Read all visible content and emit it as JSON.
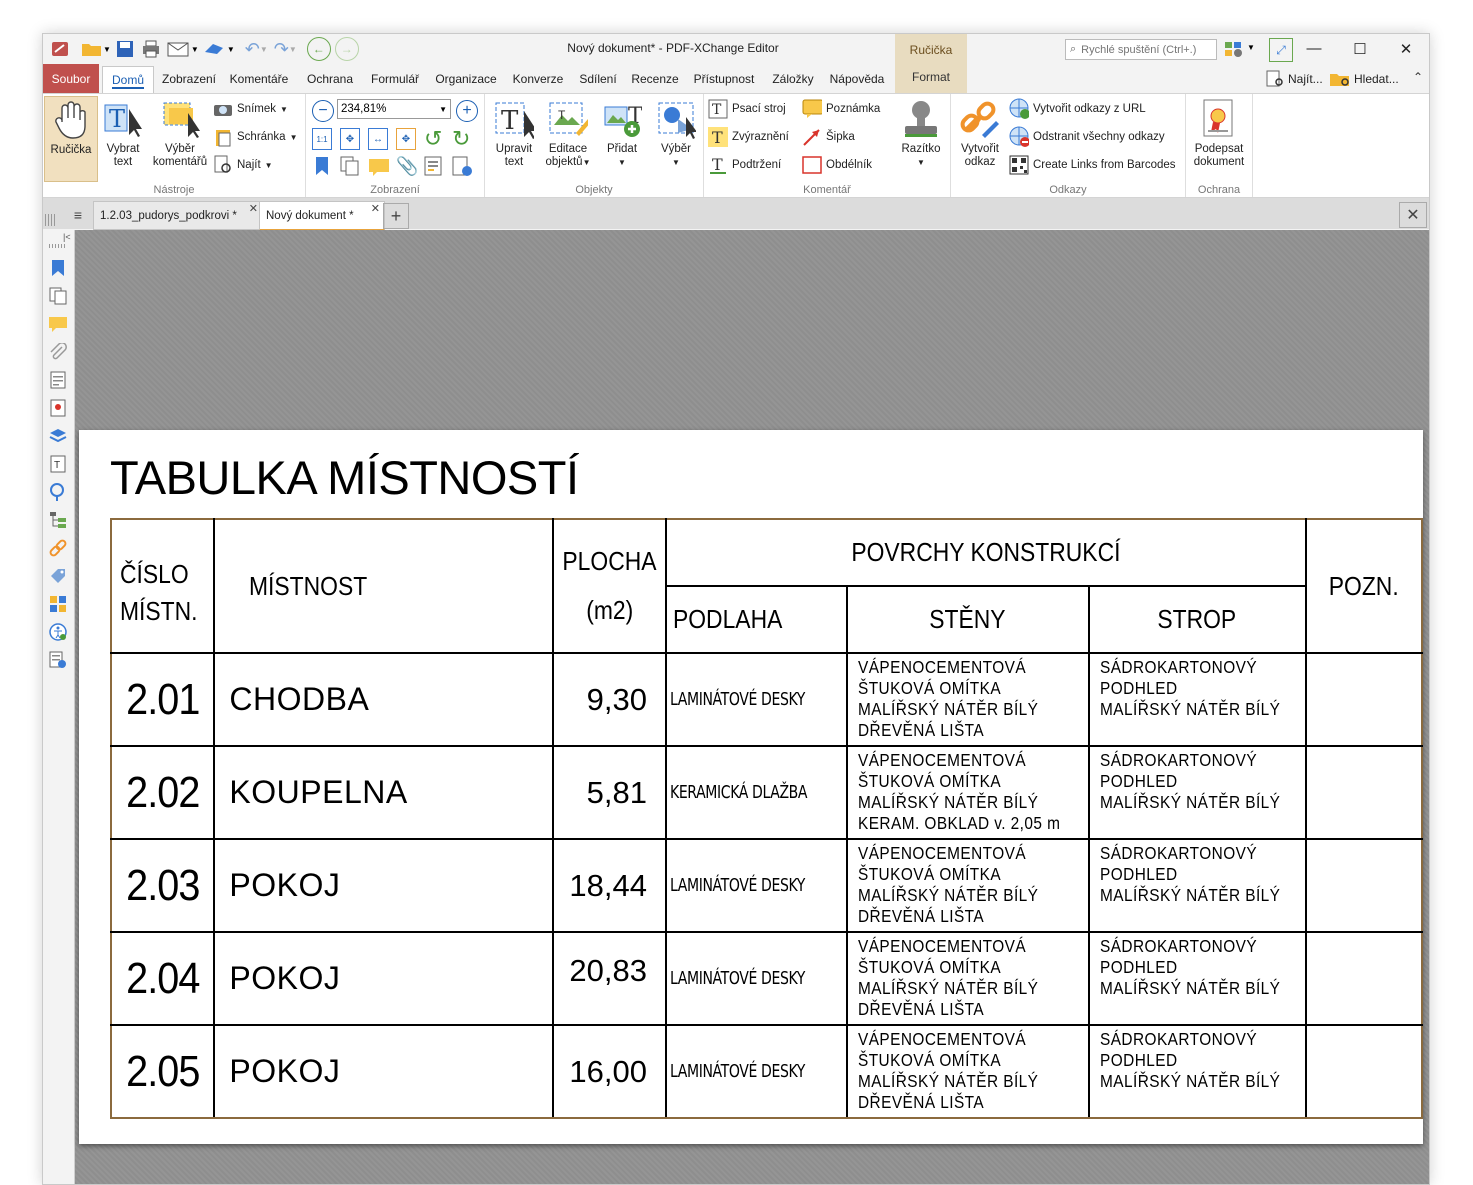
{
  "window": {
    "title": "Nový dokument* - PDF-XChange Editor",
    "context_group": "Ručička",
    "context_tab": "Format",
    "quick_launch_placeholder": "Rychlé spuštění (Ctrl+.)"
  },
  "menu": {
    "file": "Soubor",
    "tabs": [
      "Domů",
      "Zobrazení",
      "Komentáře",
      "Ochrana",
      "Formulář",
      "Organizace",
      "Konverze",
      "Sdílení",
      "Recenze",
      "Přístupnost",
      "Záložky",
      "Nápověda"
    ],
    "find_label": "Najít...",
    "search_label": "Hledat..."
  },
  "ribbon": {
    "tools": {
      "label": "Nástroje",
      "hand": "Ručička",
      "select_text": [
        "Vybrat",
        "text"
      ],
      "select_comments": [
        "Výběr",
        "komentářů"
      ],
      "snapshot": "Snímek",
      "clipboard": "Schránka",
      "find": "Najít"
    },
    "view": {
      "label": "Zobrazení",
      "zoom_value": "234,81%"
    },
    "objects": {
      "label": "Objekty",
      "edit_text": [
        "Upravit",
        "text"
      ],
      "edit_objects": [
        "Editace",
        "objektů"
      ],
      "add": "Přidat",
      "selection": "Výběr"
    },
    "comment": {
      "label": "Komentář",
      "typewriter": "Psací stroj",
      "highlight": "Zvýraznění",
      "underline": "Podtržení",
      "note": "Poznámka",
      "arrow": "Šipka",
      "rectangle": "Obdélník",
      "stamp": "Razítko"
    },
    "links": {
      "label": "Odkazy",
      "create_link": [
        "Vytvořit",
        "odkaz"
      ],
      "create_from_url": "Vytvořit odkazy z URL",
      "remove_all": "Odstranit všechny odkazy",
      "from_barcodes": "Create Links from Barcodes"
    },
    "protect": {
      "label": "Ochrana",
      "sign": [
        "Podepsat",
        "dokument"
      ]
    }
  },
  "doc_tabs": [
    "1.2.03_pudorys_podkrovi *",
    "Nový dokument *"
  ],
  "document": {
    "title": "TABULKA MÍSTNOSTÍ",
    "headers": {
      "number": [
        "ČÍSLO",
        "MÍSTN."
      ],
      "room": "MÍSTNOST",
      "area": [
        "PLOCHA",
        "(m2)"
      ],
      "surfaces": "POVRCHY KONSTRUKCÍ",
      "floor": "PODLAHA",
      "walls": "STĚNY",
      "ceiling": "STROP",
      "note": "POZN."
    },
    "rows": [
      {
        "number": "2.01",
        "room": "CHODBA",
        "area": "9,30",
        "floor": "LAMINÁTOVÉ DESKY",
        "walls": [
          "VÁPENOCEMENTOVÁ",
          "ŠTUKOVÁ OMÍTKA",
          "MALÍŘSKÝ NÁTĚR BÍLÝ",
          "DŘEVĚNÁ LIŠTA"
        ],
        "ceiling": [
          "SÁDROKARTONOVÝ",
          "PODHLED",
          "MALÍŘSKÝ NÁTĚR BÍLÝ"
        ]
      },
      {
        "number": "2.02",
        "room": "KOUPELNA",
        "area": "5,81",
        "floor": "KERAMICKÁ DLAŽBA",
        "walls": [
          "VÁPENOCEMENTOVÁ",
          "ŠTUKOVÁ OMÍTKA",
          "MALÍŘSKÝ NÁTĚR BÍLÝ",
          "KERAM. OBKLAD v. 2,05 m"
        ],
        "ceiling": [
          "SÁDROKARTONOVÝ",
          "PODHLED",
          "MALÍŘSKÝ NÁTĚR BÍLÝ"
        ]
      },
      {
        "number": "2.03",
        "room": "POKOJ",
        "area": "18,44",
        "floor": "LAMINÁTOVÉ DESKY",
        "walls": [
          "VÁPENOCEMENTOVÁ",
          "ŠTUKOVÁ OMÍTKA",
          "MALÍŘSKÝ NÁTĚR BÍLÝ",
          "DŘEVĚNÁ LIŠTA"
        ],
        "ceiling": [
          "SÁDROKARTONOVÝ",
          "PODHLED",
          "MALÍŘSKÝ NÁTĚR BÍLÝ"
        ]
      },
      {
        "number": "2.04",
        "room": "POKOJ",
        "area": "20,83",
        "floor": "LAMINÁTOVÉ DESKY",
        "walls": [
          "VÁPENOCEMENTOVÁ",
          "ŠTUKOVÁ OMÍTKA",
          "MALÍŘSKÝ NÁTĚR BÍLÝ",
          "DŘEVĚNÁ LIŠTA"
        ],
        "ceiling": [
          "SÁDROKARTONOVÝ",
          "PODHLED",
          "MALÍŘSKÝ NÁTĚR BÍLÝ"
        ]
      },
      {
        "number": "2.05",
        "room": "POKOJ",
        "area": "16,00",
        "floor": "LAMINÁTOVÉ DESKY",
        "walls": [
          "VÁPENOCEMENTOVÁ",
          "ŠTUKOVÁ OMÍTKA",
          "MALÍŘSKÝ NÁTĚR BÍLÝ",
          "DŘEVĚNÁ LIŠTA"
        ],
        "ceiling": [
          "SÁDROKARTONOVÝ",
          "PODHLED",
          "MALÍŘSKÝ NÁTĚR BÍLÝ"
        ]
      }
    ]
  },
  "colors": {
    "file_tab": "#c0504d",
    "accent": "#1b5fb3",
    "table_border_accent": "#8b6a3e",
    "active_tab_underline": "#e8a33c"
  }
}
